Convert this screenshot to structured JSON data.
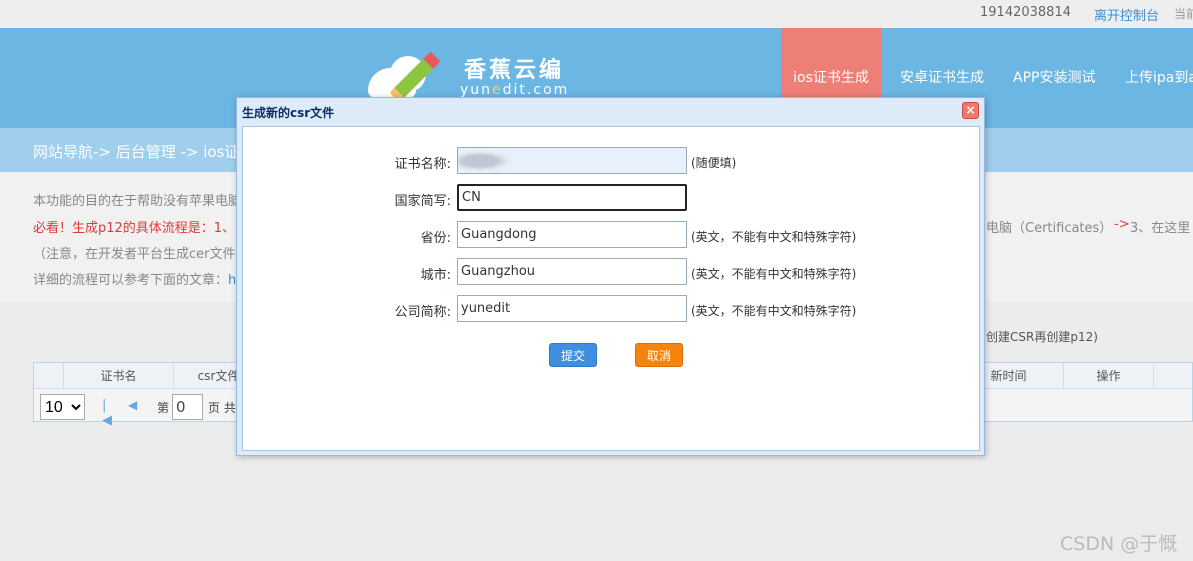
{
  "topbar": {
    "phone": "19142038814",
    "console_link": "离开控制台",
    "current": "当前"
  },
  "logo": {
    "title": "香蕉云编",
    "sub_pre": "yun",
    "sub_e": "e",
    "sub_post": "dit.com"
  },
  "nav": [
    "ios证书生成",
    "安卓证书生成",
    "APP安装测试",
    "上传ipa到ap"
  ],
  "breadcrumb": "网站导航-> 后台管理 -> ios证",
  "main": {
    "line1": "本功能的目的在于帮助没有苹果电脑",
    "line2": "必看！生成p12的具体流程是：1、",
    "line2_right_a": "电脑（Certificates）",
    "line2_right_arrow": "->",
    "line2_right_b": " 3、在这里",
    "line3": "（注意，在开发者平台生成cer文件",
    "line4_pre": "详细的流程可以参考下面的文章：",
    "line4_link": "h",
    "hint_right": "创建CSR再创建p12)"
  },
  "grid": {
    "columns": [
      "证书名",
      "csr文件",
      "新时间",
      "操作"
    ],
    "page_size": "10",
    "page_label_pre": "第",
    "page_value": "0",
    "page_label_post": "页 共"
  },
  "dialog": {
    "title": "生成新的csr文件",
    "close": "×",
    "fields": [
      {
        "label": "证书名称:",
        "value": "",
        "note": "(随便填)"
      },
      {
        "label": "国家简写:",
        "value": "CN",
        "note": ""
      },
      {
        "label": "省份:",
        "value": "Guangdong",
        "note": "(英文，不能有中文和特殊字符)"
      },
      {
        "label": "城市:",
        "value": "Guangzhou",
        "note": "(英文，不能有中文和特殊字符)"
      },
      {
        "label": "公司简称:",
        "value": "yunedit",
        "note": "(英文，不能有中文和特殊字符)"
      }
    ],
    "submit": "提交",
    "cancel": "取消"
  },
  "watermark": "CSDN @于慨"
}
